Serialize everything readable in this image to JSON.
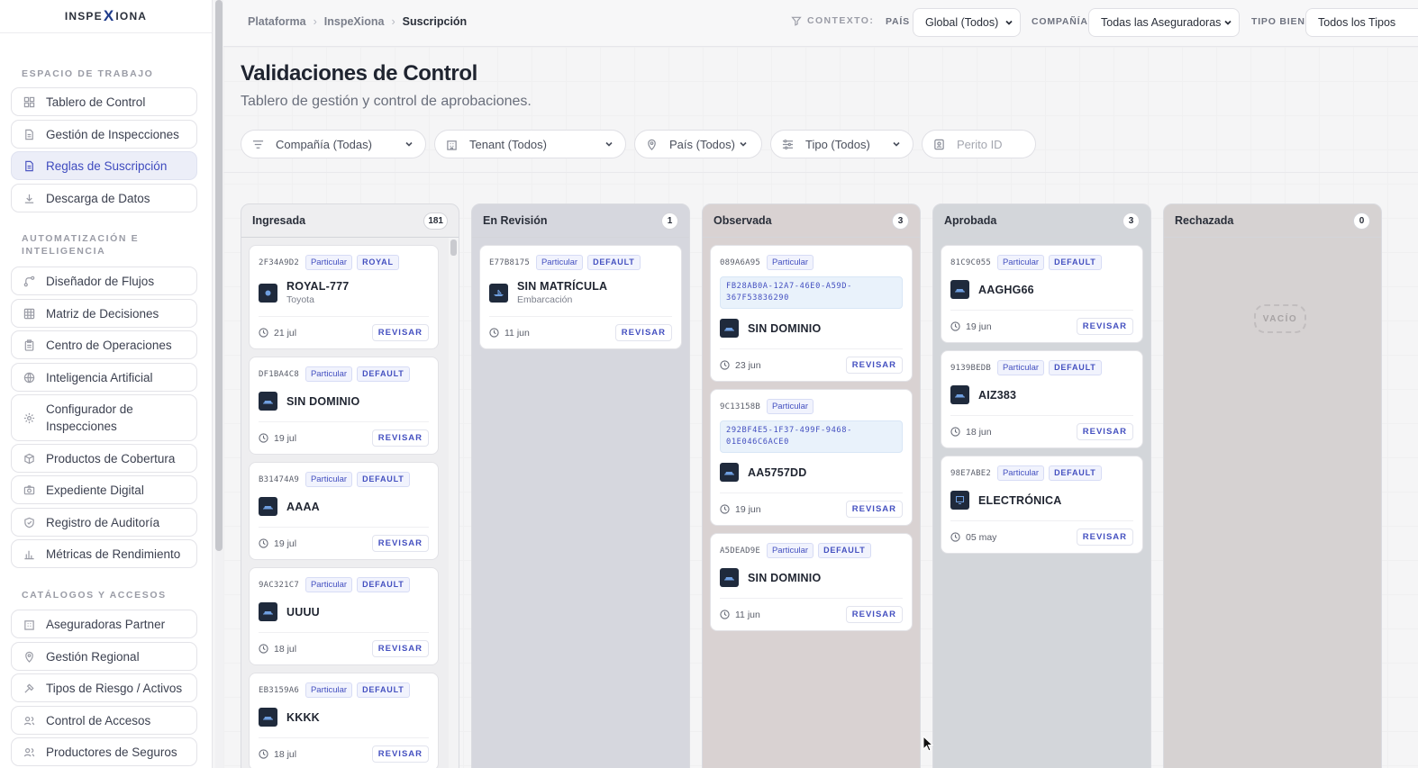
{
  "sidebar": {
    "logo_left": "INSPE",
    "logo_x": "X",
    "logo_right": "IONA",
    "sections": [
      {
        "title": "ESPACIO DE TRABAJO",
        "items": [
          {
            "label": "Tablero de Control",
            "icon": "dashboard-icon"
          },
          {
            "label": "Gestión de Inspecciones",
            "icon": "document-icon"
          },
          {
            "label": "Reglas de Suscripción",
            "icon": "document-icon",
            "active": true
          },
          {
            "label": "Descarga de Datos",
            "icon": "download-icon"
          }
        ]
      },
      {
        "title": "AUTOMATIZACIÓN E INTELIGENCIA",
        "items": [
          {
            "label": "Diseñador de Flujos",
            "icon": "flow-icon"
          },
          {
            "label": "Matriz de Decisiones",
            "icon": "grid-icon"
          },
          {
            "label": "Centro de Operaciones",
            "icon": "clipboard-icon"
          },
          {
            "label": "Inteligencia Artificial",
            "icon": "globe-icon"
          },
          {
            "label": "Configurador de Inspecciones",
            "icon": "gear-icon"
          },
          {
            "label": "Productos de Cobertura",
            "icon": "box-icon"
          },
          {
            "label": "Expediente Digital",
            "icon": "camera-icon"
          },
          {
            "label": "Registro de Auditoría",
            "icon": "shield-icon"
          },
          {
            "label": "Métricas de Rendimiento",
            "icon": "bar-chart-icon"
          }
        ]
      },
      {
        "title": "CATÁLOGOS Y ACCESOS",
        "items": [
          {
            "label": "Aseguradoras Partner",
            "icon": "building-icon"
          },
          {
            "label": "Gestión Regional",
            "icon": "map-pin-icon"
          },
          {
            "label": "Tipos de Riesgo / Activos",
            "icon": "hammer-icon"
          },
          {
            "label": "Control de Accesos",
            "icon": "users-icon"
          },
          {
            "label": "Productores de Seguros",
            "icon": "users-icon"
          }
        ]
      }
    ]
  },
  "breadcrumb": [
    "Plataforma",
    "InspeXiona",
    "Suscripción"
  ],
  "context": {
    "label": "CONTEXTO:",
    "pais_label": "PAÍS",
    "pais_value": "Global (Todos)",
    "compania_label": "COMPAÑÍA",
    "compania_value": "Todas las Aseguradoras",
    "tipo_label": "TIPO BIEN",
    "tipo_value": "Todos los Tipos"
  },
  "page": {
    "title": "Validaciones de Control",
    "subtitle": "Tablero de gestión y control de aprobaciones."
  },
  "filters": {
    "compania": "Compañía (Todas)",
    "tenant": "Tenant (Todos)",
    "pais": "País (Todos)",
    "tipo": "Tipo (Todos)",
    "perito_placeholder": "Perito ID"
  },
  "review_label": "REVISAR",
  "empty_label": "VACÍO",
  "columns": [
    {
      "name": "Ingresada",
      "count": "181",
      "cards": [
        {
          "id": "2F34A9D2",
          "tags": [
            "Particular",
            "ROYAL"
          ],
          "plate": "ROYAL-777",
          "sub": "Toyota",
          "date": "21 jul",
          "icon": "seal-icon"
        },
        {
          "id": "DF1BA4C8",
          "tags": [
            "Particular",
            "DEFAULT"
          ],
          "plate": "SIN DOMINIO",
          "date": "19 jul",
          "icon": "car-icon"
        },
        {
          "id": "B31474A9",
          "tags": [
            "Particular",
            "DEFAULT"
          ],
          "plate": "AAAA",
          "date": "19 jul",
          "icon": "car-icon"
        },
        {
          "id": "9AC321C7",
          "tags": [
            "Particular",
            "DEFAULT"
          ],
          "plate": "UUUU",
          "date": "18 jul",
          "icon": "car-icon"
        },
        {
          "id": "EB3159A6",
          "tags": [
            "Particular",
            "DEFAULT"
          ],
          "plate": "KKKK",
          "date": "18 jul",
          "icon": "car-icon"
        }
      ]
    },
    {
      "name": "En Revisión",
      "count": "1",
      "cards": [
        {
          "id": "E77B8175",
          "tags": [
            "Particular",
            "DEFAULT"
          ],
          "plate": "SIN MATRÍCULA",
          "sub": "Embarcación",
          "date": "11 jun",
          "icon": "boat-icon"
        }
      ]
    },
    {
      "name": "Observada",
      "count": "3",
      "cards": [
        {
          "id": "089A6A95",
          "tags": [
            "Particular"
          ],
          "uuid": "FB28AB0A-12A7-46E0-A59D-367F53836290",
          "plate": "SIN DOMINIO",
          "date": "23 jun",
          "icon": "car-icon"
        },
        {
          "id": "9C13158B",
          "tags": [
            "Particular"
          ],
          "uuid": "292BF4E5-1F37-499F-9468-01E046C6ACE0",
          "plate": "AA5757DD",
          "date": "19 jun",
          "icon": "car-icon"
        },
        {
          "id": "A5DEAD9E",
          "tags": [
            "Particular",
            "DEFAULT"
          ],
          "plate": "SIN DOMINIO",
          "date": "11 jun",
          "icon": "car-icon"
        }
      ]
    },
    {
      "name": "Aprobada",
      "count": "3",
      "cards": [
        {
          "id": "81C9C055",
          "tags": [
            "Particular",
            "DEFAULT"
          ],
          "plate": "AAGHG66",
          "date": "19 jun",
          "icon": "car-icon"
        },
        {
          "id": "9139BEDB",
          "tags": [
            "Particular",
            "DEFAULT"
          ],
          "plate": "AIZ383",
          "date": "18 jun",
          "icon": "car-icon"
        },
        {
          "id": "98E7ABE2",
          "tags": [
            "Particular",
            "DEFAULT"
          ],
          "plate": "ELECTRÓNICA",
          "date": "05 may",
          "icon": "monitor-icon"
        }
      ]
    },
    {
      "name": "Rechazada",
      "count": "0",
      "cards": []
    }
  ]
}
